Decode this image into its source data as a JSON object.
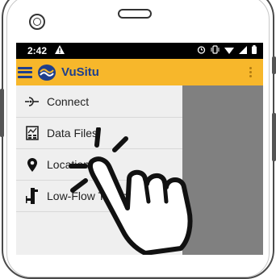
{
  "status_bar": {
    "time": "2:42",
    "warning_icon": "warning-triangle-icon",
    "right_icons": [
      "alarm-icon",
      "vibrate-icon",
      "wifi-icon",
      "signal-icon",
      "battery-icon"
    ]
  },
  "app_bar": {
    "title": "VuSitu",
    "menu_icon": "hamburger-menu-icon",
    "overflow_icon": "kebab-menu-icon"
  },
  "drawer": {
    "items": [
      {
        "label": "Connect",
        "icon": "connect-plug-icon"
      },
      {
        "label": "Data Files",
        "icon": "chart-file-icon"
      },
      {
        "label": "Location",
        "icon": "location-pin-icon"
      },
      {
        "label": "Low-Flow Testing",
        "icon": "flow-pipe-icon"
      }
    ]
  },
  "colors": {
    "accent": "#f7b72b",
    "brand": "#1f3f8c",
    "scrim": "#808080",
    "drawer_bg": "#efefef"
  },
  "overlay": {
    "icon": "tap-hand-icon"
  }
}
